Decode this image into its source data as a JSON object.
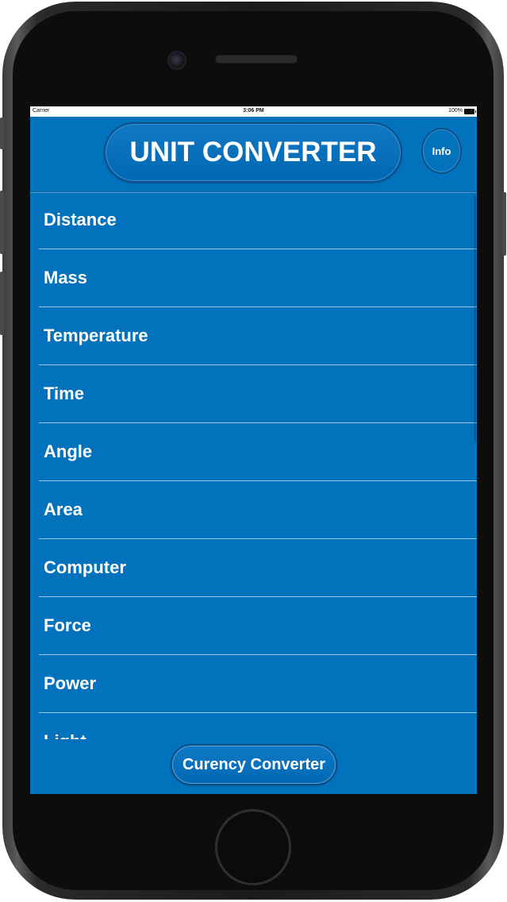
{
  "status_bar": {
    "carrier": "Carrier",
    "time": "3:06 PM",
    "battery": "100%"
  },
  "header": {
    "title": "UNIT CONVERTER",
    "info_label": "Info"
  },
  "categories": [
    {
      "label": "Distance"
    },
    {
      "label": "Mass"
    },
    {
      "label": "Temperature"
    },
    {
      "label": "Time"
    },
    {
      "label": "Angle"
    },
    {
      "label": "Area"
    },
    {
      "label": "Computer"
    },
    {
      "label": "Force"
    },
    {
      "label": "Power"
    },
    {
      "label": "Light"
    }
  ],
  "footer": {
    "currency_label": "Curency Converter"
  },
  "colors": {
    "screen_background": "#0272bd",
    "text": "#ffffff"
  }
}
